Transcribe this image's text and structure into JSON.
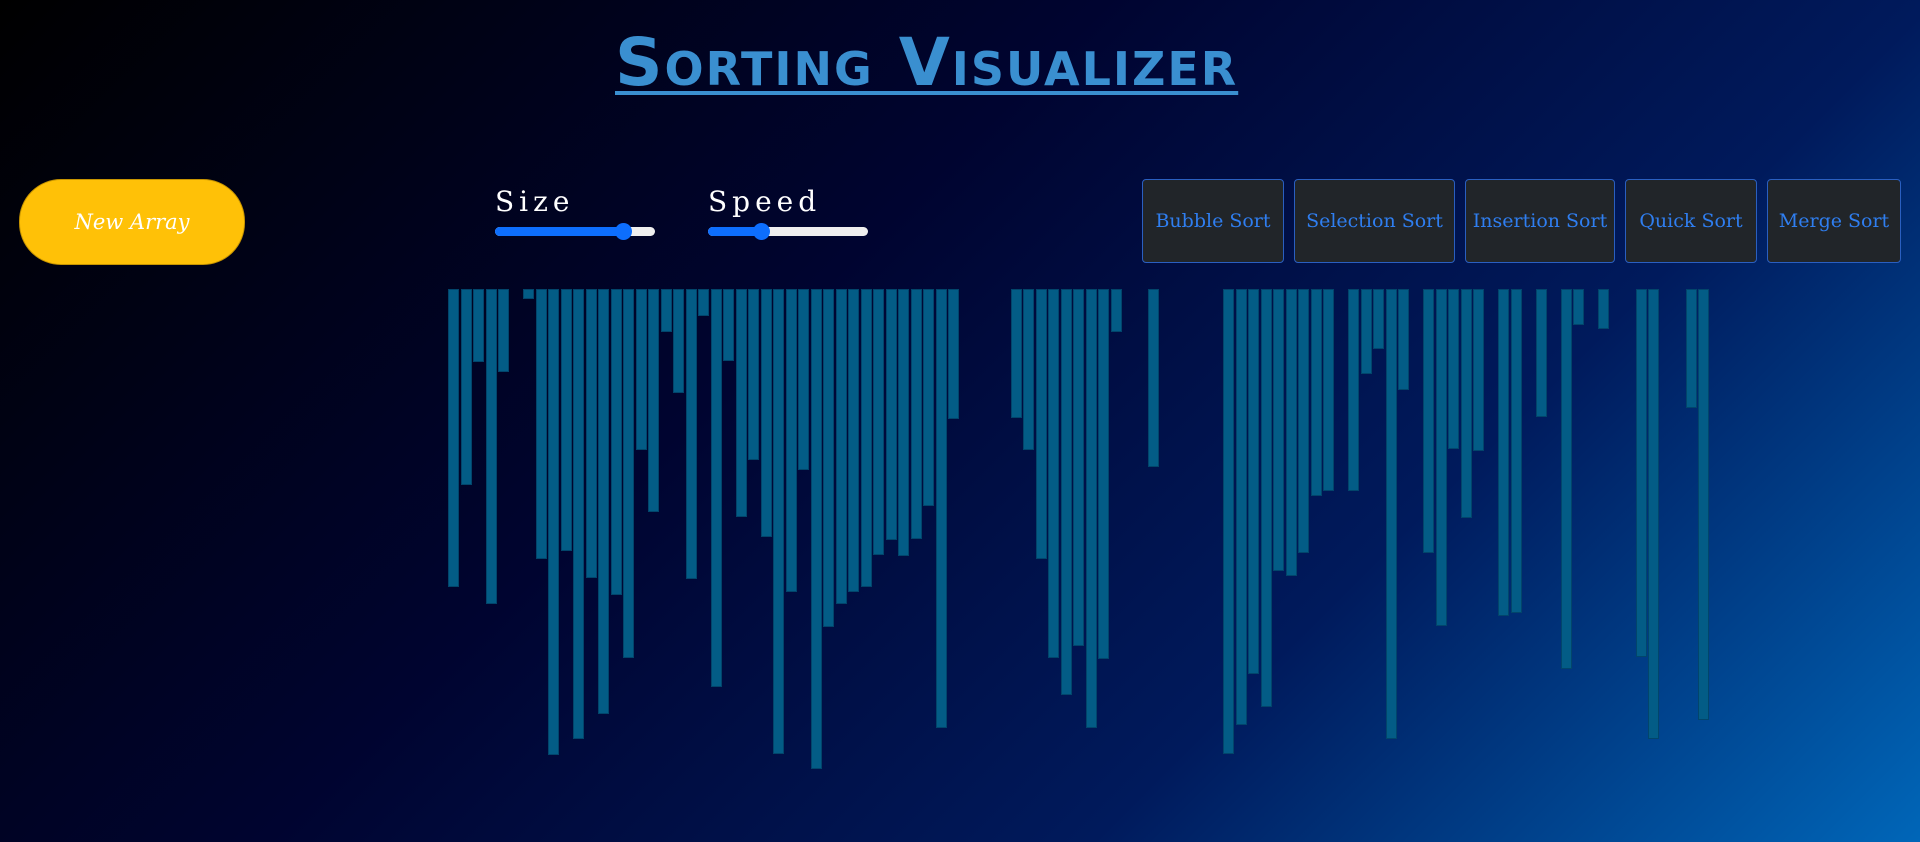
{
  "title": "Sorting Visualizer",
  "controls": {
    "new_array_label": "New Array",
    "size_label": "Size",
    "size_value": 0.8,
    "speed_label": "Speed",
    "speed_value": 0.33
  },
  "algorithms": [
    "Bubble Sort",
    "Selection Sort",
    "Insertion Sort",
    "Quick Sort",
    "Merge Sort"
  ],
  "colors": {
    "bar": "#035c86",
    "new_array_button": "#ffc107",
    "algorithm_button_bg": "#212529",
    "algorithm_button_text": "#2f7ef0",
    "slider": "#0d6efd"
  },
  "array": [
    298,
    196,
    73,
    315,
    83,
    0,
    10,
    270,
    466,
    262,
    450,
    289,
    425,
    306,
    369,
    161,
    223,
    43,
    104,
    290,
    27,
    398,
    72,
    228,
    171,
    248,
    465,
    303,
    181,
    480,
    338,
    315,
    303,
    298,
    266,
    251,
    267,
    250,
    217,
    439,
    130,
    0,
    0,
    0,
    0,
    129,
    161,
    270,
    369,
    406,
    357,
    439,
    370,
    43,
    0,
    0,
    178,
    0,
    0,
    0,
    0,
    0,
    465,
    436,
    385,
    418,
    282,
    287,
    264,
    207,
    202,
    0,
    202,
    85,
    60,
    450,
    101,
    0,
    264,
    337,
    160,
    229,
    162,
    0,
    327,
    324,
    0,
    128,
    0,
    380,
    36,
    0,
    40,
    0,
    0,
    368,
    450,
    0,
    0,
    119,
    431
  ]
}
